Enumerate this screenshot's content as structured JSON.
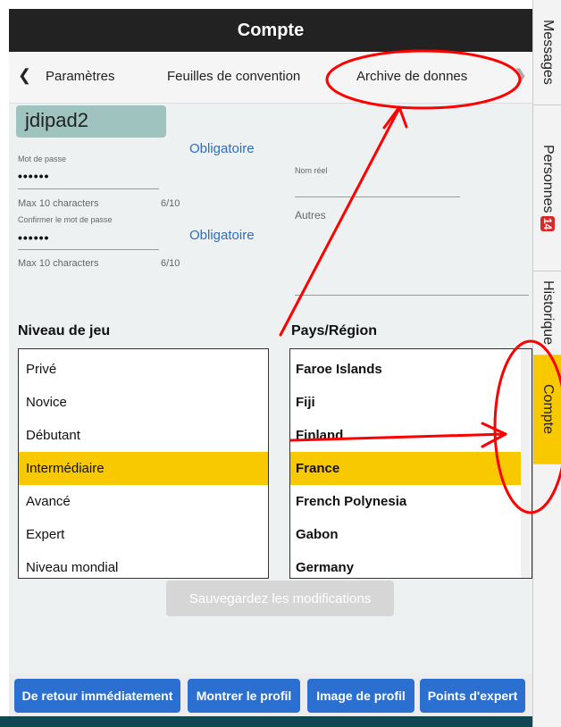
{
  "window": {
    "title": "Compte"
  },
  "tabs": {
    "prev_icon": "chevron-left-icon",
    "next_icon": "chevron-right-icon",
    "items": [
      {
        "label": "Paramètres"
      },
      {
        "label": "Feuilles de convention"
      },
      {
        "label": "Archive de donnes"
      }
    ]
  },
  "account": {
    "username": "jdipad2",
    "password": {
      "label": "Mot de passe",
      "value": "••••••",
      "required": "Obligatoire",
      "hint": "Max 10 characters",
      "count": "6/10"
    },
    "confirm": {
      "label": "Confirmer le mot de passe",
      "value": "••••••",
      "required": "Obligatoire",
      "hint": "Max 10 characters",
      "count": "6/10"
    },
    "real_name": {
      "label": "Nom réel",
      "value": ""
    },
    "others": {
      "label": "Autres",
      "value": ""
    }
  },
  "level": {
    "heading": "Niveau de jeu",
    "items": [
      "Privé",
      "Novice",
      "Débutant",
      "Intermédiaire",
      "Avancé",
      "Expert",
      "Niveau mondial"
    ],
    "selected": "Intermédiaire"
  },
  "country": {
    "heading": "Pays/Région",
    "items": [
      "Faroe Islands",
      "Fiji",
      "Finland",
      "France",
      "French Polynesia",
      "Gabon",
      "Germany"
    ],
    "selected": "France"
  },
  "save_button": "Sauvegardez les modifications",
  "bottom_buttons": [
    {
      "label": "De retour immédiatement"
    },
    {
      "label": "Montrer le profil"
    },
    {
      "label": "Image de profil"
    },
    {
      "label": "Points d'expert"
    }
  ],
  "sidebar": [
    {
      "label": "Messages"
    },
    {
      "label": "Personnes",
      "badge": "14"
    },
    {
      "label": "Historique"
    },
    {
      "label": "Compte",
      "active": true
    }
  ],
  "colors": {
    "title_bar": "#222222",
    "selection": "#f9c900",
    "accent_blue": "#2b6fd0",
    "required_text": "#2a6fc4",
    "annotation": "#ff0000",
    "badge": "#d62b2b"
  }
}
